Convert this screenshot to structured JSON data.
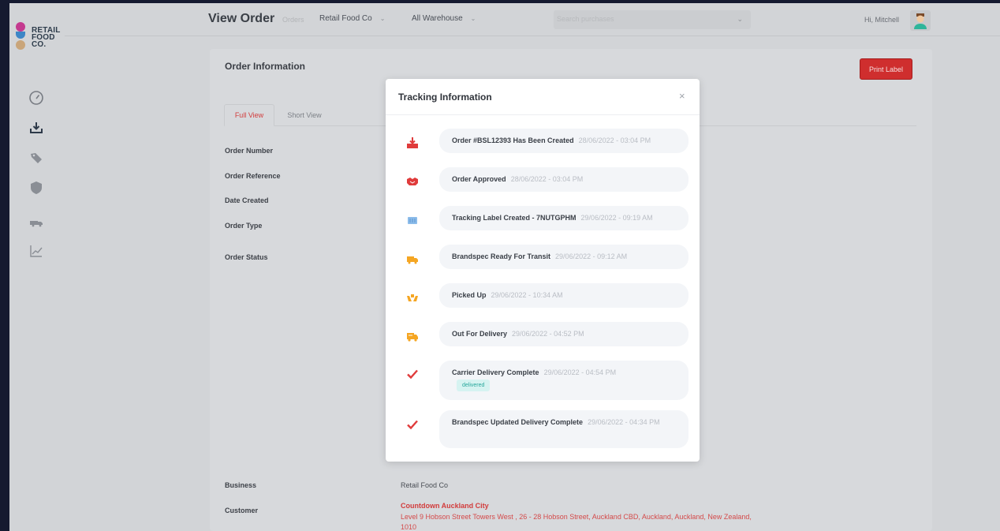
{
  "app": {
    "logo": {
      "lines": [
        "RETAIL",
        "FOOD",
        "CO."
      ]
    },
    "sidebar": {
      "items": [
        {
          "icon": "gauge-icon"
        },
        {
          "icon": "download-tray-icon",
          "active": true
        },
        {
          "icon": "tags-icon"
        },
        {
          "icon": "shield-icon"
        },
        {
          "icon": "truck-icon"
        },
        {
          "icon": "chart-line-icon"
        }
      ]
    },
    "header": {
      "title": "View Order",
      "breadcrumb": "Orders",
      "business_select": "Retail Food Co",
      "warehouse_select": "All Warehouse",
      "search_placeholder": "Search purchases",
      "greeting": "Hi, Mitchell"
    }
  },
  "order": {
    "section_title": "Order Information",
    "print_label": "Print Label",
    "tabs": [
      {
        "label": "Full View",
        "active": true
      },
      {
        "label": "Short View",
        "active": false
      }
    ],
    "fields": {
      "order_number": "Order Number",
      "order_reference": "Order Reference",
      "date_created": "Date Created",
      "order_type": "Order Type",
      "order_status": "Order Status",
      "business_label": "Business",
      "business_value": "Retail Food Co",
      "customer_label": "Customer",
      "customer_name": "Countdown Auckland City",
      "customer_address": "Level 9 Hobson Street Towers West , 26 - 28 Hobson Street, Auckland CBD, Auckland, Auckland, New Zealand, 1010"
    }
  },
  "modal": {
    "title": "Tracking Information",
    "close_label": "×",
    "events": [
      {
        "label": "Order #BSL12393 Has Been Created",
        "time": "28/06/2022 - 03:04 PM",
        "icon": "download-tray-icon",
        "color": "#e03b3b"
      },
      {
        "label": "Order Approved",
        "time": "28/06/2022 - 03:04 PM",
        "icon": "handshake-icon",
        "color": "#e03b3b"
      },
      {
        "label": "Tracking Label Created - 7NUTGPHM",
        "time": "29/06/2022 - 09:19 AM",
        "icon": "label-icon",
        "color": "#7fb2e6"
      },
      {
        "label": "Brandspec Ready For Transit",
        "time": "29/06/2022 - 09:12 AM",
        "icon": "truck-icon",
        "color": "#f5a623"
      },
      {
        "label": "Picked Up",
        "time": "29/06/2022 - 10:34 AM",
        "icon": "hands-icon",
        "color": "#f5a623"
      },
      {
        "label": "Out For Delivery",
        "time": "29/06/2022 - 04:52 PM",
        "icon": "delivery-truck-icon",
        "color": "#f5a623"
      },
      {
        "label": "Carrier Delivery Complete",
        "time": "29/06/2022 - 04:54 PM",
        "icon": "check-icon",
        "color": "#e03b3b",
        "badge": "delivered"
      },
      {
        "label": "Brandspec Updated Delivery Complete",
        "time": "29/06/2022 - 04:34 PM",
        "icon": "check-icon",
        "color": "#e03b3b"
      }
    ]
  }
}
